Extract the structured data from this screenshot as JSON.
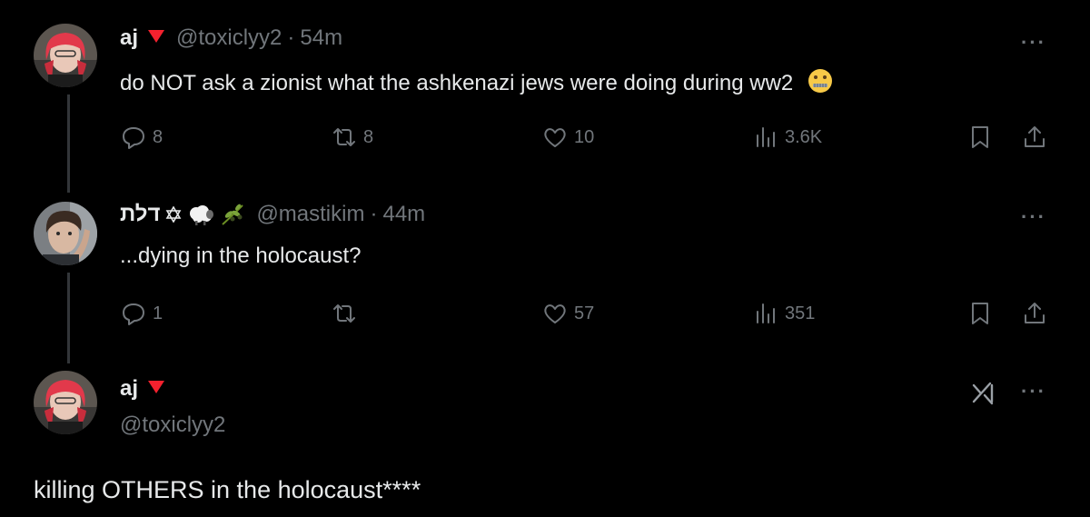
{
  "tweet1": {
    "name": "aj",
    "handle": "@toxiclyy2",
    "sep": "·",
    "time": "54m",
    "text": "do NOT ask a zionist what the ashkenazi jews were doing during ww2",
    "emoji": "zipper-mouth-face",
    "replies": "8",
    "retweets": "8",
    "likes": "10",
    "views": "3.6K",
    "more": "···"
  },
  "tweet2": {
    "name": "דלת",
    "badges": [
      "star-of-david-icon",
      "sheep-emoji",
      "olive-branch-emoji"
    ],
    "handle": "@mastikim",
    "sep": "·",
    "time": "44m",
    "text": "...dying in the holocaust?",
    "replies": "1",
    "likes": "57",
    "views": "351",
    "more": "···"
  },
  "tweet3": {
    "name": "aj",
    "handle": "@toxiclyy2",
    "text": "killing OTHERS in the holocaust****",
    "grok_icon": "grok-icon",
    "more": "···"
  },
  "colors": {
    "background": "#000000",
    "text": "#e7e9ea",
    "muted": "#71767b",
    "thread_line": "#333639",
    "badge_red": "#f4212e"
  }
}
